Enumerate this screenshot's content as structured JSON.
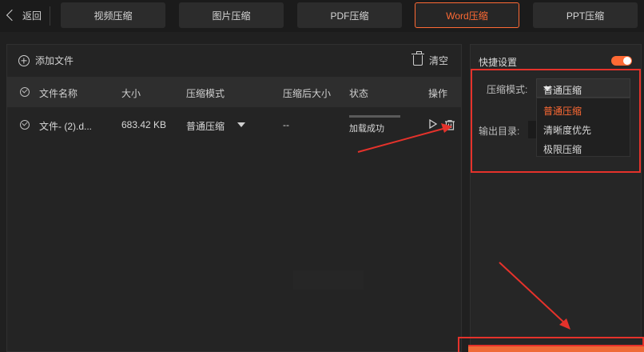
{
  "header": {
    "back_label": "返回",
    "tabs": [
      {
        "label": "视频压缩"
      },
      {
        "label": "图片压缩"
      },
      {
        "label": "PDF压缩"
      },
      {
        "label": "Word压缩"
      },
      {
        "label": "PPT压缩"
      }
    ],
    "active_tab": "Word压缩"
  },
  "file_panel": {
    "add_file_label": "添加文件",
    "clear_label": "清空",
    "columns": [
      "文件名称",
      "大小",
      "压缩模式",
      "压缩后大小",
      "状态",
      "操作"
    ],
    "rows": [
      {
        "name": "文件- (2).d...",
        "size": "683.42 KB",
        "mode": "普通压缩",
        "compressed_size": "--",
        "status": "加载成功"
      }
    ]
  },
  "settings": {
    "title": "快捷设置",
    "toggle_on": true,
    "mode_label": "压缩模式:",
    "mode_value": "普通压缩",
    "output_label": "输出目录:",
    "options": [
      "普通压缩",
      "清晰度优先",
      "极限压缩"
    ],
    "selected_option": "普通压缩"
  },
  "colors": {
    "accent": "#ff6a34",
    "annotation": "#e5322b",
    "background": "#202020"
  }
}
